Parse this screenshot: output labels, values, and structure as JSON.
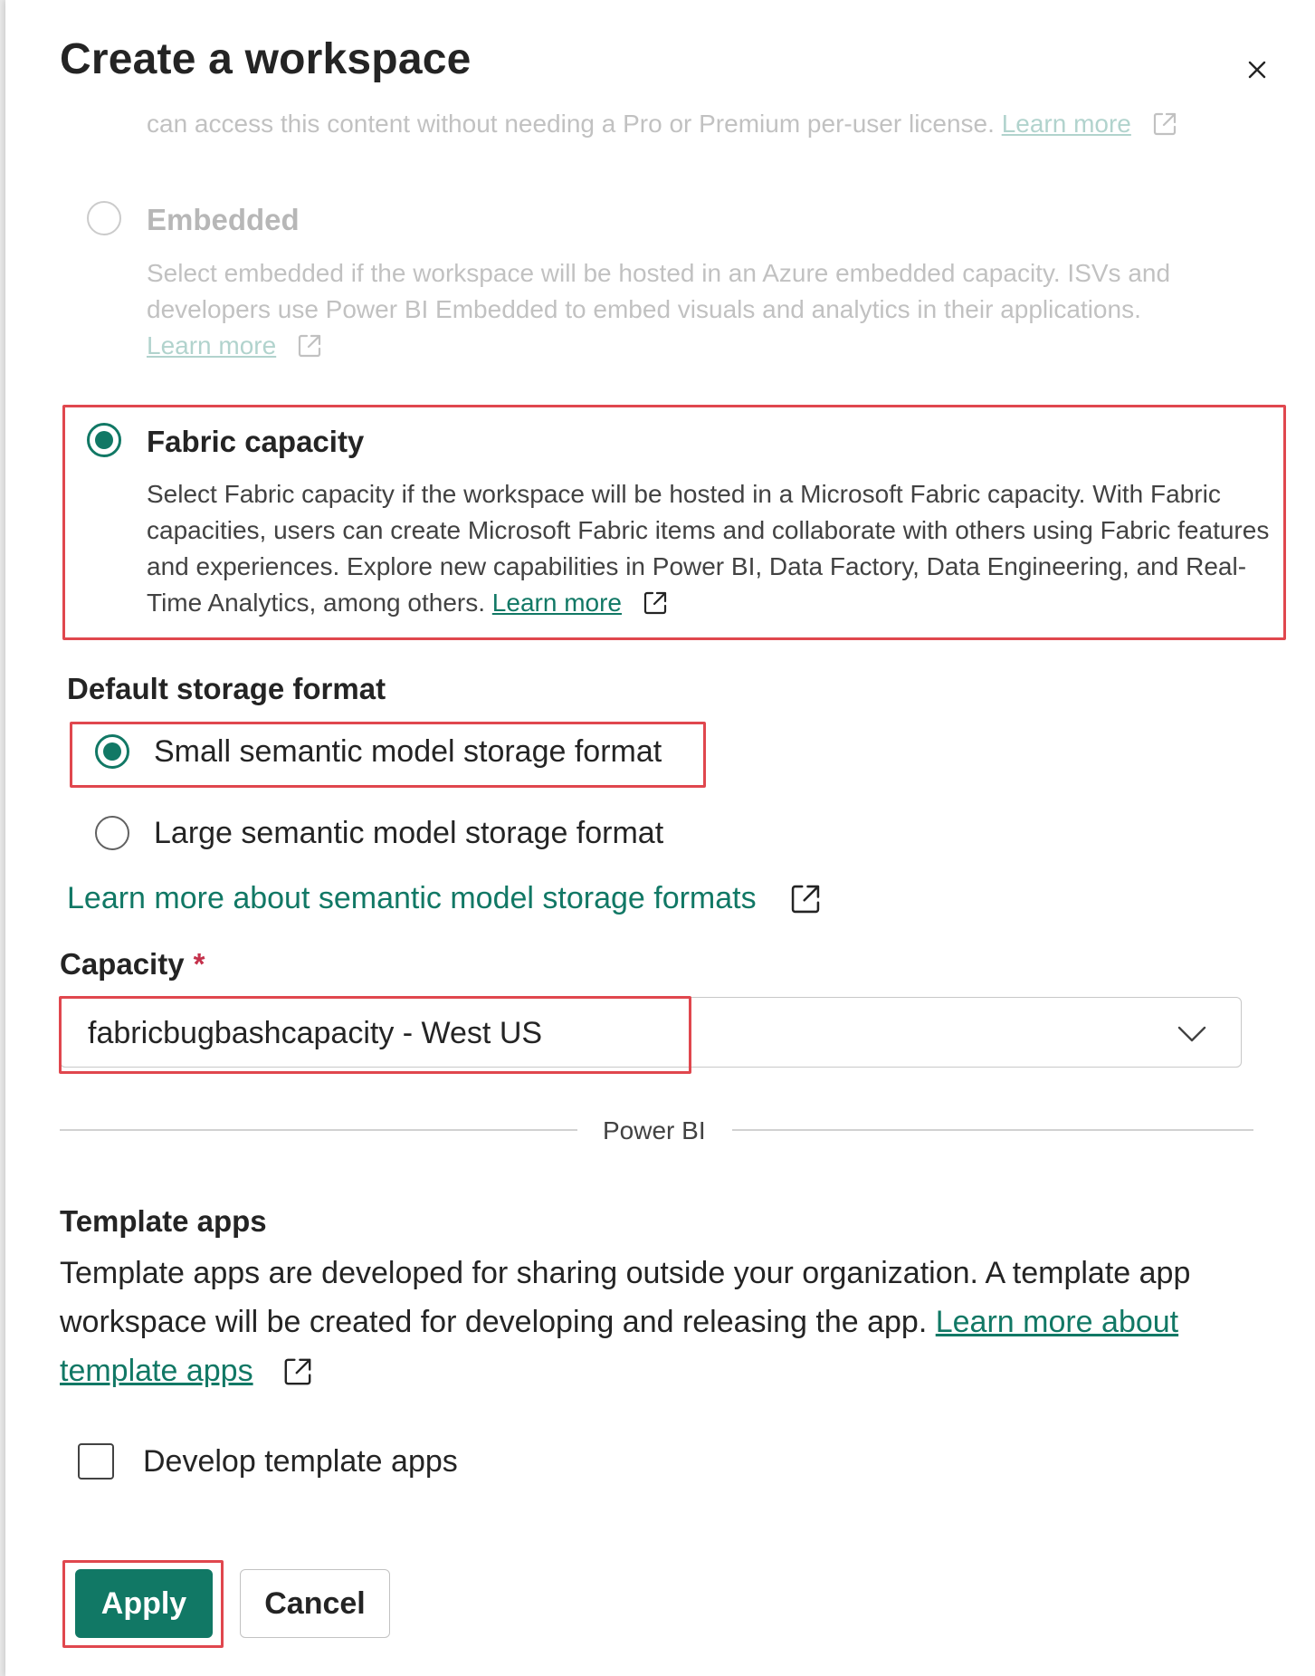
{
  "dialog": {
    "title": "Create a workspace"
  },
  "licenses": {
    "pro_tail_text": "can access this content without needing a Pro or Premium per-user license.",
    "pro_learn_more": "Learn more",
    "embedded": {
      "title": "Embedded",
      "description": "Select embedded if the workspace will be hosted in an Azure embedded capacity. ISVs and developers use Power BI Embedded to embed visuals and analytics in their applications.",
      "learn_more": "Learn more",
      "selected": false
    },
    "fabric": {
      "title": "Fabric capacity",
      "description": "Select Fabric capacity if the workspace will be hosted in a Microsoft Fabric capacity. With Fabric capacities, users can create Microsoft Fabric items and collaborate with others using Fabric features and experiences. Explore new capabilities in Power BI, Data Factory, Data Engineering, and Real-Time Analytics, among others.",
      "learn_more": "Learn more",
      "selected": true
    }
  },
  "storage": {
    "heading": "Default storage format",
    "small_label": "Small semantic model storage format",
    "small_selected": true,
    "large_label": "Large semantic model storage format",
    "large_selected": false,
    "learn_more": "Learn more about semantic model storage formats"
  },
  "capacity": {
    "label": "Capacity",
    "required_mark": "*",
    "value": "fabricbugbashcapacity - West US"
  },
  "divider": {
    "label": "Power BI"
  },
  "template_apps": {
    "heading": "Template apps",
    "description": "Template apps are developed for sharing outside your organization. A template app workspace will be created for developing and releasing the app.",
    "learn_more": "Learn more about template apps",
    "checkbox_label": "Develop template apps",
    "checked": false
  },
  "actions": {
    "apply": "Apply",
    "cancel": "Cancel"
  },
  "colors": {
    "accent": "#117865",
    "highlight": "#e0474e"
  }
}
